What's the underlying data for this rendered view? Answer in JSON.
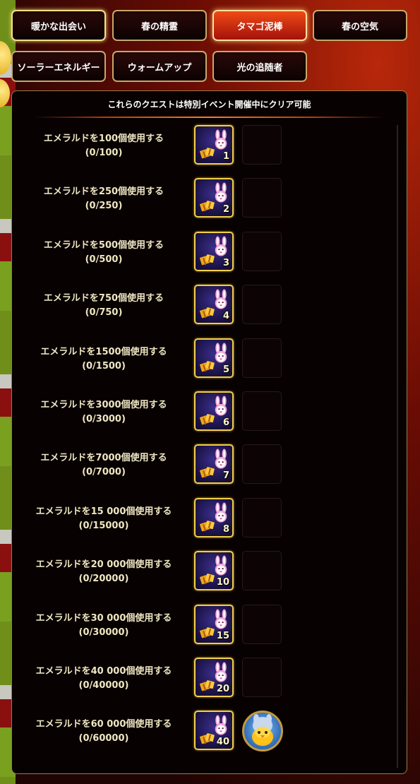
{
  "tabs": [
    {
      "label": "暖かな出会い",
      "state": "selected"
    },
    {
      "label": "春の精霊",
      "state": "normal"
    },
    {
      "label": "タマゴ泥棒",
      "state": "active"
    },
    {
      "label": "春の空気",
      "state": "normal"
    },
    {
      "label": "ソーラーエネルギー",
      "state": "normal"
    },
    {
      "label": "ウォームアップ",
      "state": "normal"
    },
    {
      "label": "光の追随者",
      "state": "normal"
    }
  ],
  "panel": {
    "header": "これらのクエストは特別イベント開催中にクリア可能"
  },
  "quests": [
    {
      "title": "エメラルドを100個使用する",
      "progress": "(0/100)",
      "reward_qty": "1"
    },
    {
      "title": "エメラルドを250個使用する",
      "progress": "(0/250)",
      "reward_qty": "2"
    },
    {
      "title": "エメラルドを500個使用する",
      "progress": "(0/500)",
      "reward_qty": "3"
    },
    {
      "title": "エメラルドを750個使用する",
      "progress": "(0/750)",
      "reward_qty": "4"
    },
    {
      "title": "エメラルドを1500個使用する",
      "progress": "(0/1500)",
      "reward_qty": "5"
    },
    {
      "title": "エメラルドを3000個使用する",
      "progress": "(0/3000)",
      "reward_qty": "6"
    },
    {
      "title": "エメラルドを7000個使用する",
      "progress": "(0/7000)",
      "reward_qty": "7"
    },
    {
      "title": "エメラルドを15 000個使用する",
      "progress": "(0/15000)",
      "reward_qty": "8"
    },
    {
      "title": "エメラルドを20 000個使用する",
      "progress": "(0/20000)",
      "reward_qty": "10"
    },
    {
      "title": "エメラルドを30 000個使用する",
      "progress": "(0/30000)",
      "reward_qty": "15"
    },
    {
      "title": "エメラルドを40 000個使用する",
      "progress": "(0/40000)",
      "reward_qty": "20"
    },
    {
      "title": "エメラルドを60 000個使用する",
      "progress": "(0/60000)",
      "reward_qty": "40"
    }
  ],
  "colors": {
    "accent": "#f2cf4a",
    "active_tab": "#e03a12",
    "text": "#efe6c2"
  }
}
